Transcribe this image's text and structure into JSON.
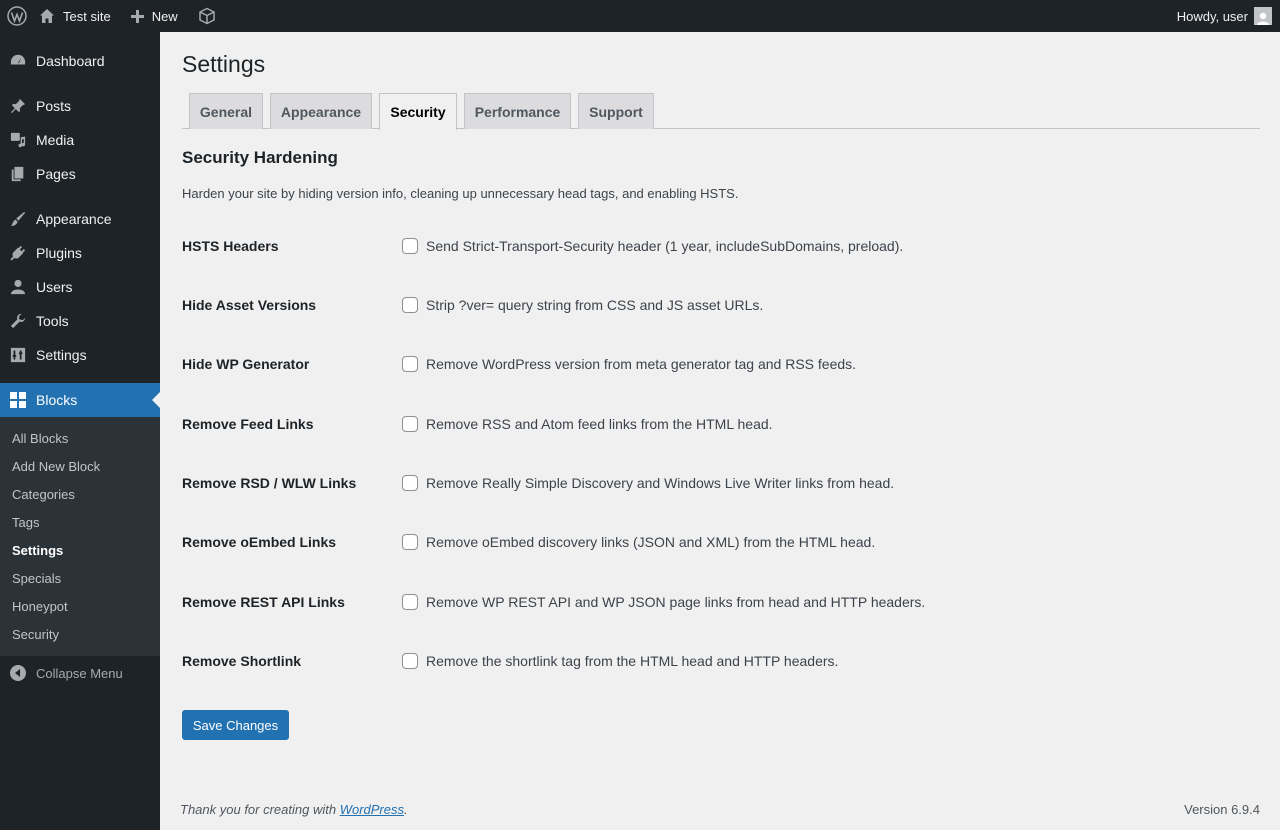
{
  "adminbar": {
    "site_name": "Test site",
    "new_label": "New",
    "greeting": "Howdy, user"
  },
  "sidebar": {
    "items": [
      {
        "label": "Dashboard"
      },
      {
        "label": "Posts"
      },
      {
        "label": "Media"
      },
      {
        "label": "Pages"
      },
      {
        "label": "Appearance"
      },
      {
        "label": "Plugins"
      },
      {
        "label": "Users"
      },
      {
        "label": "Tools"
      },
      {
        "label": "Settings"
      },
      {
        "label": "Blocks"
      }
    ],
    "submenu": [
      {
        "label": "All Blocks"
      },
      {
        "label": "Add New Block"
      },
      {
        "label": "Categories"
      },
      {
        "label": "Tags"
      },
      {
        "label": "Settings"
      },
      {
        "label": "Specials"
      },
      {
        "label": "Honeypot"
      },
      {
        "label": "Security"
      }
    ],
    "collapse_label": "Collapse Menu"
  },
  "page": {
    "title": "Settings",
    "tabs": [
      {
        "label": "General"
      },
      {
        "label": "Appearance"
      },
      {
        "label": "Security"
      },
      {
        "label": "Performance"
      },
      {
        "label": "Support"
      }
    ],
    "active_tab": "Security",
    "section_title": "Security Hardening",
    "section_desc": "Harden your site by hiding version info, cleaning up unnecessary head tags, and enabling HSTS.",
    "settings": [
      {
        "label": "HSTS Headers",
        "desc": "Send Strict-Transport-Security header (1 year, includeSubDomains, preload).",
        "checked": false
      },
      {
        "label": "Hide Asset Versions",
        "desc": "Strip ?ver= query string from CSS and JS asset URLs.",
        "checked": false
      },
      {
        "label": "Hide WP Generator",
        "desc": "Remove WordPress version from meta generator tag and RSS feeds.",
        "checked": false
      },
      {
        "label": "Remove Feed Links",
        "desc": "Remove RSS and Atom feed links from the HTML head.",
        "checked": false
      },
      {
        "label": "Remove RSD / WLW Links",
        "desc": "Remove Really Simple Discovery and Windows Live Writer links from head.",
        "checked": false
      },
      {
        "label": "Remove oEmbed Links",
        "desc": "Remove oEmbed discovery links (JSON and XML) from the HTML head.",
        "checked": false
      },
      {
        "label": "Remove REST API Links",
        "desc": "Remove WP REST API and WP JSON page links from head and HTTP headers.",
        "checked": false
      },
      {
        "label": "Remove Shortlink",
        "desc": "Remove the shortlink tag from the HTML head and HTTP headers.",
        "checked": false
      }
    ],
    "save_label": "Save Changes"
  },
  "footer": {
    "thanks_prefix": "Thank you for creating with ",
    "link_text": "WordPress",
    "thanks_suffix": ".",
    "version": "Version 6.9.4"
  },
  "colors": {
    "accent": "#2271b1",
    "admin_dark": "#1d2327",
    "submenu_bg": "#2c3338",
    "background": "#f0f0f1"
  }
}
